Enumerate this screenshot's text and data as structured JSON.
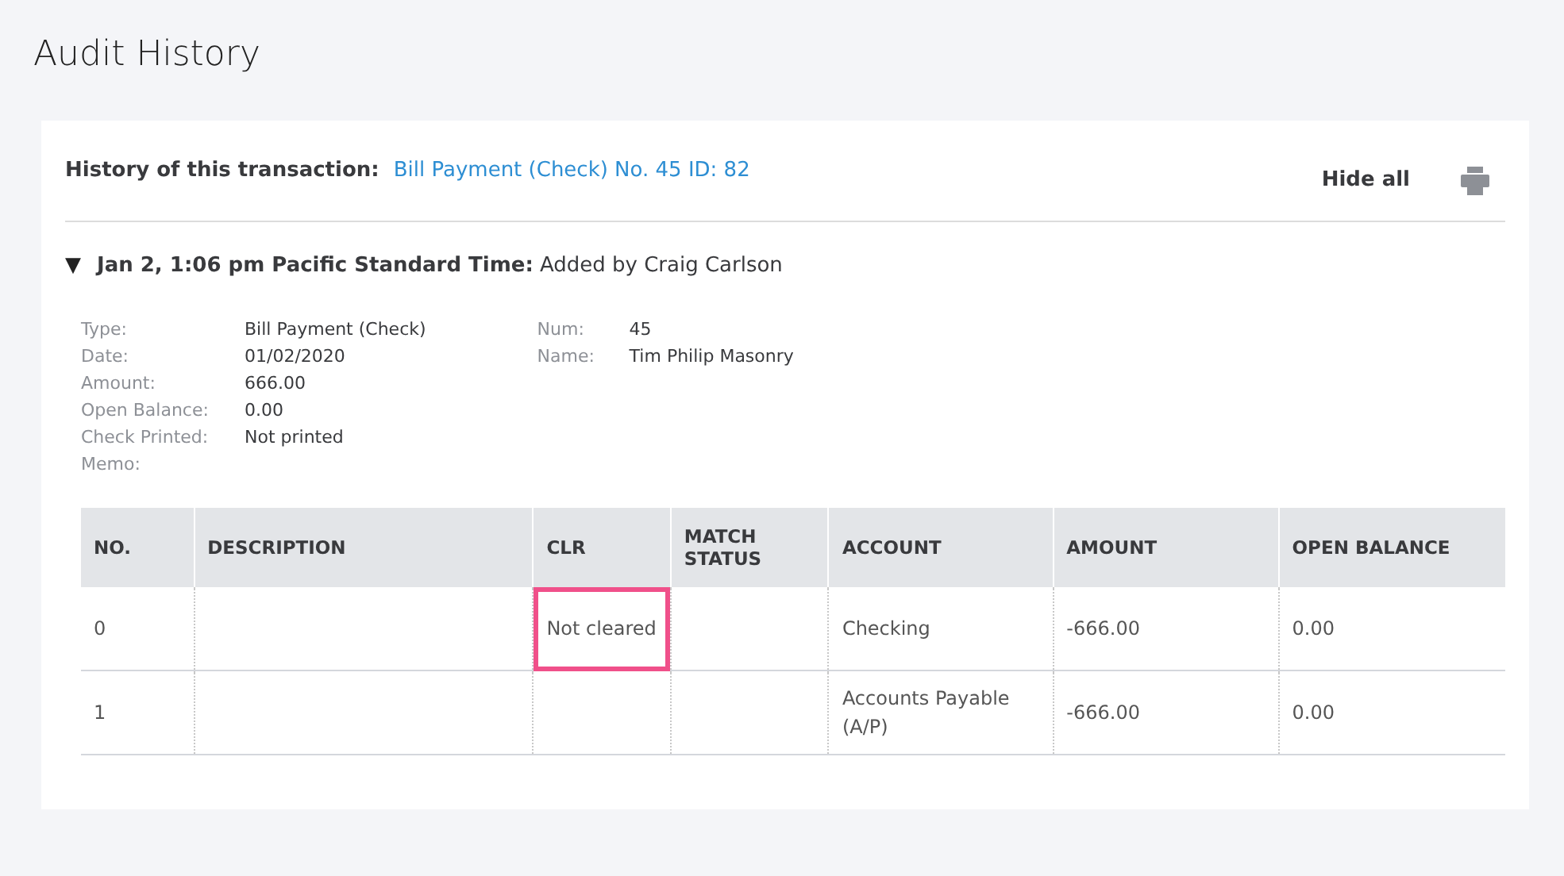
{
  "page_title": "Audit History",
  "history": {
    "label": "History of this transaction:",
    "link": "Bill Payment (Check) No. 45 ID: 82",
    "hide_button": "Hide all"
  },
  "entry": {
    "expanded": true,
    "toggle": "▼",
    "timestamp": "Jan 2, 1:06 pm Pacific Standard Time:",
    "action": "Added by Craig Carlson",
    "fields_left": [
      {
        "label": "Type:",
        "value": "Bill Payment (Check)"
      },
      {
        "label": "Date:",
        "value": "01/02/2020"
      },
      {
        "label": "Amount:",
        "value": "666.00"
      },
      {
        "label": "Open Balance:",
        "value": "0.00"
      },
      {
        "label": "Check Printed:",
        "value": "Not printed"
      },
      {
        "label": "Memo:"
      }
    ],
    "fields_right": [
      {
        "label": "Num:",
        "value": "45"
      },
      {
        "label": "Name:",
        "value": "Tim Philip Masonry"
      }
    ],
    "table": {
      "columns": [
        "NO.",
        "DESCRIPTION",
        "CLR",
        "MATCH STATUS",
        "ACCOUNT",
        "AMOUNT",
        "OPEN BALANCE"
      ],
      "rows": [
        {
          "cells": [
            {
              "text": "0"
            },
            {},
            {
              "text": "Not cleared",
              "highlighted": true
            },
            {},
            {
              "text": "Checking"
            },
            {
              "text": "-666.00"
            },
            {
              "text": "0.00"
            }
          ]
        },
        {
          "cells": [
            {
              "text": "1"
            },
            {},
            {},
            {},
            {
              "text": "Accounts Payable (A/P)"
            },
            {
              "text": "-666.00"
            },
            {
              "text": "0.00"
            }
          ]
        }
      ]
    }
  }
}
